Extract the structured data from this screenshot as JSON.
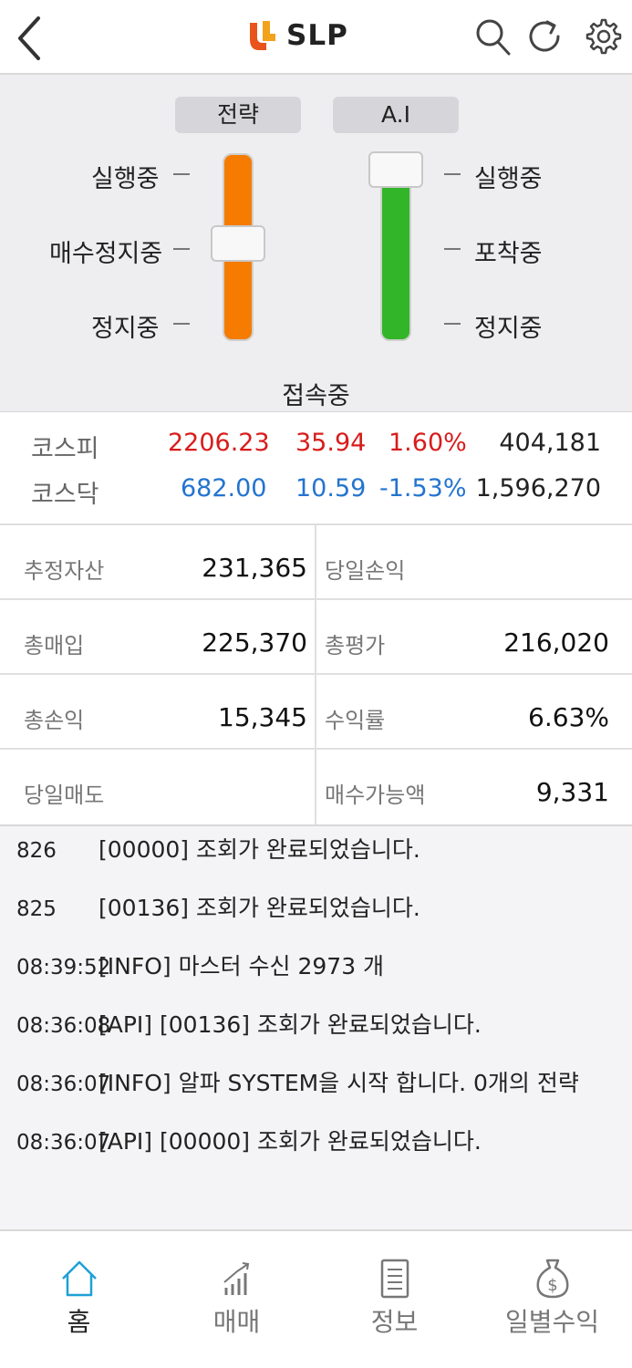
{
  "header": {
    "brand": "SLP",
    "icons": [
      "back-icon",
      "search-icon",
      "refresh-icon",
      "gear-icon"
    ]
  },
  "controls": {
    "strategy": {
      "title": "전략",
      "labels": [
        "실행중",
        "매수정지중",
        "정지중"
      ],
      "selected": "매수정지중",
      "color": "#f57c00"
    },
    "ai": {
      "title": "A.I",
      "labels": [
        "실행중",
        "포착중",
        "정지중"
      ],
      "selected": "실행중",
      "color": "#33b529"
    },
    "status": "접속중"
  },
  "market": [
    {
      "name": "코스피",
      "index": "2206.23",
      "change": "35.94",
      "rate": "1.60%",
      "volume": "404,181",
      "trend": "up"
    },
    {
      "name": "코스닥",
      "index": "682.00",
      "change": "10.59",
      "rate": "-1.53%",
      "volume": "1,596,270",
      "trend": "down"
    }
  ],
  "account": {
    "est_assets_label": "추정자산",
    "est_assets": "231,365",
    "daily_pl_label": "당일손익",
    "daily_pl": "",
    "total_buy_label": "총매입",
    "total_buy": "225,370",
    "total_eval_label": "총평가",
    "total_eval": "216,020",
    "total_pl_label": "총손익",
    "total_pl": "15,345",
    "return_label": "수익률",
    "return": "6.63%",
    "daily_sell_label": "당일매도",
    "daily_sell": "",
    "buyable_label": "매수가능액",
    "buyable": "9,331"
  },
  "log": [
    {
      "time": "826",
      "msg": "[00000] 조회가 완료되었습니다."
    },
    {
      "time": "825",
      "msg": "[00136] 조회가 완료되었습니다."
    },
    {
      "time": "08:39:52",
      "msg": "[INFO] 마스터 수신 2973 개"
    },
    {
      "time": "08:36:08",
      "msg": "[API] [00136] 조회가 완료되었습니다."
    },
    {
      "time": "08:36:07",
      "msg": "[INFO] 알파 SYSTEM을 시작 합니다. 0개의 전략"
    },
    {
      "time": "08:36:07",
      "msg": "[API] [00000] 조회가 완료되었습니다."
    }
  ],
  "nav": [
    {
      "label": "홈",
      "icon": "home-icon",
      "active": true
    },
    {
      "label": "매매",
      "icon": "chart-bars-icon",
      "active": false
    },
    {
      "label": "정보",
      "icon": "document-icon",
      "active": false
    },
    {
      "label": "일별수익",
      "icon": "money-bag-icon",
      "active": false
    }
  ],
  "colors": {
    "up": "#d81c1c",
    "down": "#2374cf",
    "accent": "#1ea0d6"
  }
}
